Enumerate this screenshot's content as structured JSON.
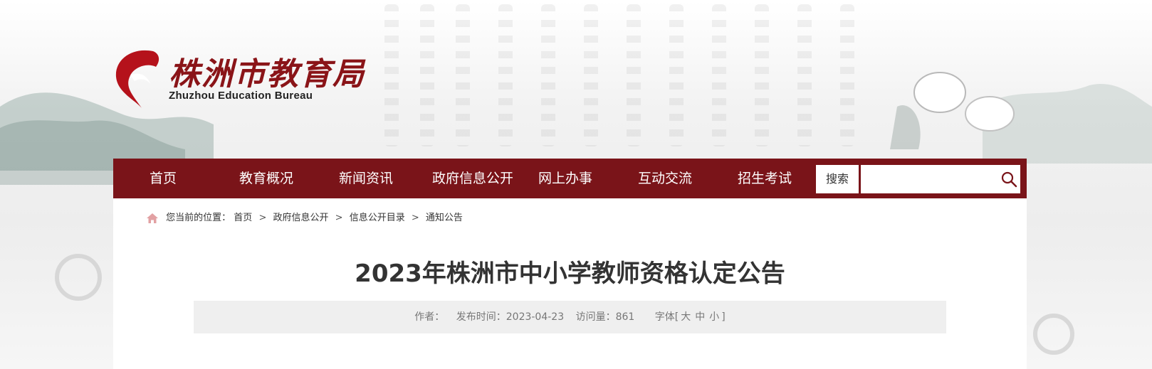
{
  "header": {
    "logo_cn": "株洲市教育局",
    "logo_en": "Zhuzhou Education Bureau"
  },
  "nav": {
    "items": [
      "首页",
      "教育概况",
      "新闻资讯",
      "政府信息公开",
      "网上办事",
      "互动交流",
      "招生考试"
    ],
    "search_label": "搜索",
    "search_value": ""
  },
  "breadcrumb": {
    "prefix": "您当前的位置：",
    "items": [
      "首页",
      "政府信息公开",
      "信息公开目录",
      "通知公告"
    ],
    "separator": ">"
  },
  "article": {
    "title": "2023年株洲市中小学教师资格认定公告",
    "author_label": "作者：",
    "author": "",
    "date_label": "发布时间：",
    "date": "2023-04-23",
    "views_label": "访问量：",
    "views": "861",
    "font_label": "字体[",
    "font_large": "大",
    "font_medium": "中",
    "font_small": "小",
    "font_close": "]"
  },
  "colors": {
    "nav_bg": "#7a1419",
    "logo_red": "#8a1418",
    "meta_bg": "#efefef"
  },
  "icons": [
    "home-icon",
    "search-icon",
    "logo-flame-icon"
  ]
}
